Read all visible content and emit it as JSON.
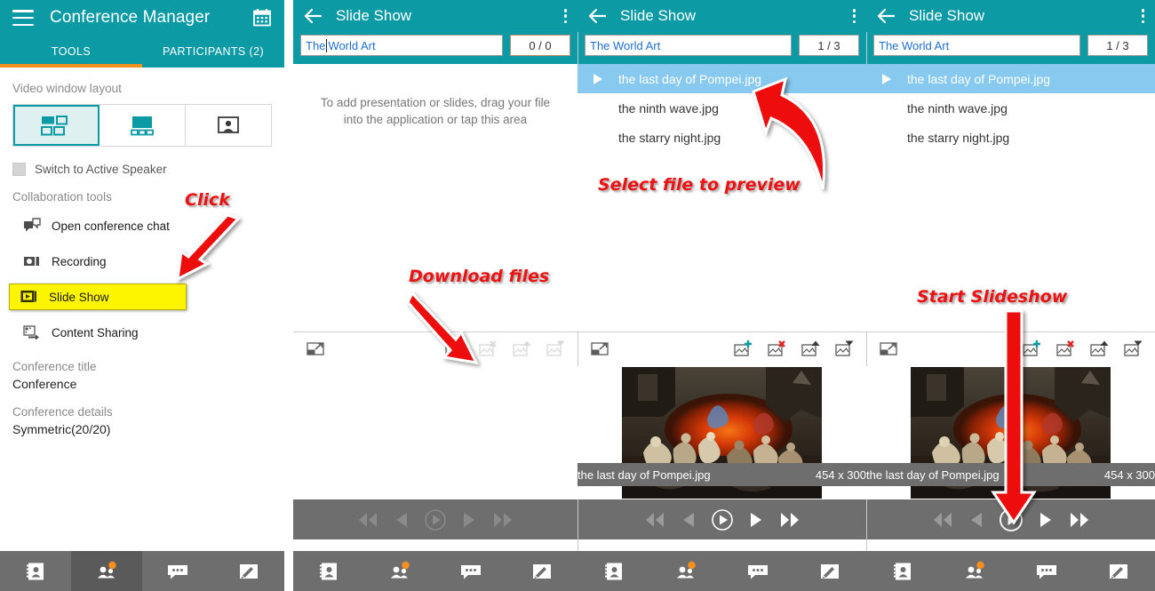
{
  "app": {
    "title": "Conference Manager",
    "menu_icon": "hamburger-icon",
    "calendar_icon": "calendar-icon"
  },
  "tabs": [
    {
      "label": "TOOLS",
      "active": true
    },
    {
      "label": "PARTICIPANTS (2)",
      "active": false
    }
  ],
  "sidebar": {
    "video_layout_label": "Video window layout",
    "layout_options": [
      {
        "name": "grid-layout",
        "selected": true
      },
      {
        "name": "presenter-layout",
        "selected": false
      },
      {
        "name": "single-speaker-layout",
        "selected": false
      }
    ],
    "active_speaker_label": "Switch to Active Speaker",
    "active_speaker_checked": false,
    "collab_label": "Collaboration tools",
    "tools": [
      {
        "label": "Open conference chat",
        "icon": "chat-icon",
        "highlight": false
      },
      {
        "label": "Recording",
        "icon": "recording-icon",
        "highlight": false
      },
      {
        "label": "Slide Show",
        "icon": "slideshow-icon",
        "highlight": true
      },
      {
        "label": "Content Sharing",
        "icon": "content-sharing-icon",
        "highlight": false
      }
    ],
    "conference_title_label": "Conference title",
    "conference_title_value": "Conference",
    "conference_details_label": "Conference details",
    "conference_details_value": "Symmetric(20/20)"
  },
  "bottom_nav": [
    {
      "name": "contacts-icon",
      "active": false
    },
    {
      "name": "participants-icon",
      "active": true,
      "badge": true
    },
    {
      "name": "chat-icon",
      "active": false
    },
    {
      "name": "compose-icon",
      "active": false
    }
  ],
  "slideshow_panels": [
    {
      "id": "panel-empty",
      "title": "Slide Show",
      "name_value": "The World Art",
      "name_prefix": "The",
      "name_suffix": "World Art",
      "has_caret": true,
      "counter": "0 / 0",
      "counter_focus": true,
      "empty_message": "To add presentation or slides, drag your file into the application or tap this area",
      "slides": [],
      "toolbar": {
        "fit_label": "fit-to-window-icon",
        "add_enabled": true,
        "delete_enabled": false,
        "move_up_enabled": false,
        "move_down_enabled": false
      },
      "preview": null,
      "playback": {
        "prev_all": false,
        "prev": false,
        "play": false,
        "next": false,
        "next_all": false
      }
    },
    {
      "id": "panel-selected",
      "title": "Slide Show",
      "name_value": "The World Art",
      "has_caret": false,
      "counter": "1 / 3",
      "counter_focus": false,
      "empty_message": "",
      "slides": [
        {
          "name": "the last day of Pompei.jpg",
          "selected": true
        },
        {
          "name": "the ninth wave.jpg",
          "selected": false
        },
        {
          "name": "the starry night.jpg",
          "selected": false
        }
      ],
      "toolbar": {
        "fit_label": "fit-to-window-icon",
        "add_enabled": true,
        "delete_enabled": true,
        "move_up_enabled": true,
        "move_down_enabled": true
      },
      "preview": {
        "filename": "the last day of Pompei.jpg",
        "dimensions": "454 x 300"
      },
      "playback": {
        "prev_all": false,
        "prev": false,
        "play": true,
        "next": true,
        "next_all": true
      }
    },
    {
      "id": "panel-playing",
      "title": "Slide Show",
      "name_value": "The World Art",
      "has_caret": false,
      "counter": "1 / 3",
      "counter_focus": false,
      "empty_message": "",
      "slides": [
        {
          "name": "the last day of Pompei.jpg",
          "selected": true
        },
        {
          "name": "the ninth wave.jpg",
          "selected": false
        },
        {
          "name": "the starry night.jpg",
          "selected": false
        }
      ],
      "toolbar": {
        "fit_label": "fit-to-window-icon",
        "add_enabled": true,
        "delete_enabled": true,
        "move_up_enabled": true,
        "move_down_enabled": true
      },
      "preview": {
        "filename": "the last day of Pompei.jpg",
        "dimensions": "454 x 300"
      },
      "playback": {
        "prev_all": false,
        "prev": false,
        "play": true,
        "next": true,
        "next_all": true
      }
    }
  ],
  "annotations": [
    {
      "text": "Click",
      "target": "slide-show-tool"
    },
    {
      "text": "Download files",
      "target": "add-slide-button"
    },
    {
      "text": "Select file to preview",
      "target": "slide-row-first"
    },
    {
      "text": "Start Slideshow",
      "target": "play-button"
    }
  ],
  "colors": {
    "teal": "#0c9aa5",
    "orange": "#f5901e",
    "highlight_yellow": "#fdf500",
    "selection_blue": "#87c9ef",
    "annotation_red": "#ee1111",
    "nav_grey": "#6e6e6e"
  }
}
